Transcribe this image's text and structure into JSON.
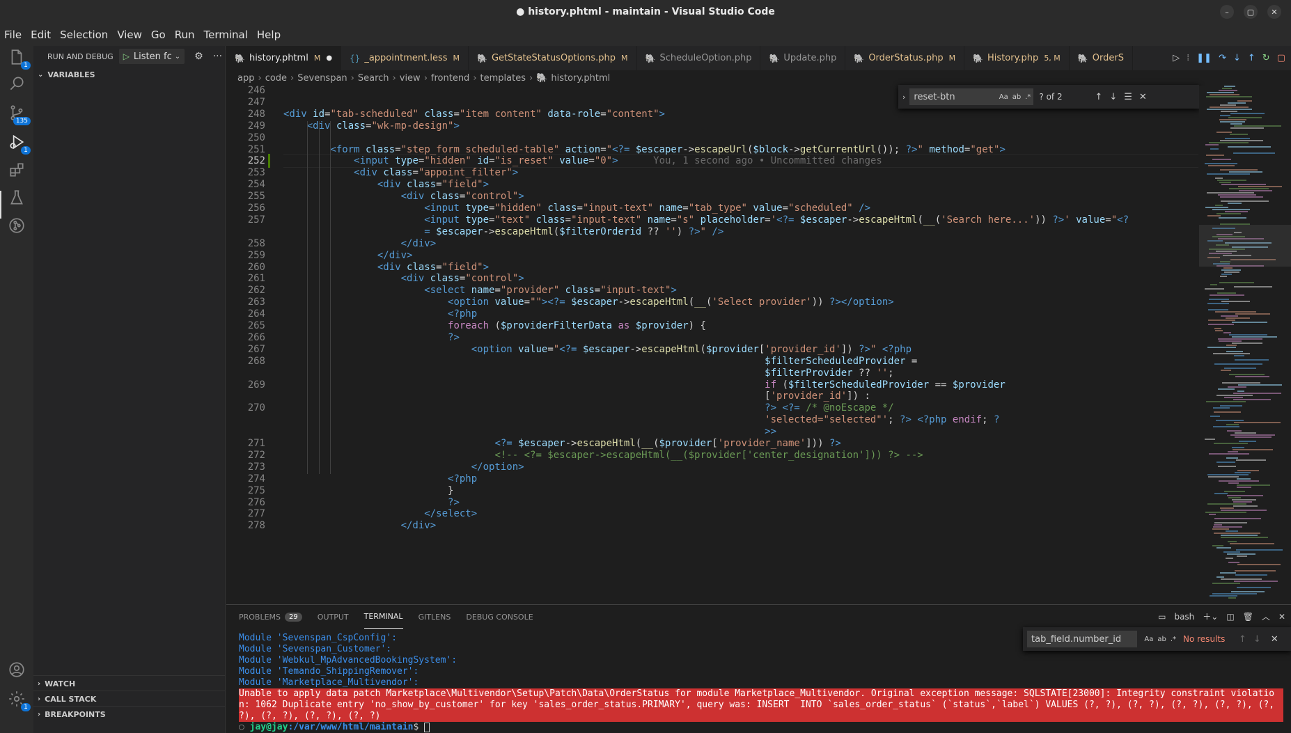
{
  "window": {
    "title": "● history.phtml - maintain - Visual Studio Code"
  },
  "menu": [
    "File",
    "Edit",
    "Selection",
    "View",
    "Go",
    "Run",
    "Terminal",
    "Help"
  ],
  "activity": {
    "scm_badge": "135",
    "explorer_badge": "1",
    "debug_badge": "1",
    "settings_badge": "1"
  },
  "sidebar": {
    "header": "RUN AND DEBUG",
    "config": "Listen fc",
    "sections": {
      "variables": "VARIABLES",
      "watch": "WATCH",
      "callstack": "CALL STACK",
      "breakpoints": "BREAKPOINTS"
    }
  },
  "tabs": [
    {
      "label": "history.phtml",
      "status": "M",
      "dirty": "●",
      "icon_color": "#a074c4"
    },
    {
      "label": "_appointment.less",
      "status": "M",
      "icon": "{}"
    },
    {
      "label": "GetStateStatusOptions.php",
      "status": "M"
    },
    {
      "label": "ScheduleOption.php",
      "status": ""
    },
    {
      "label": "Update.php",
      "status": ""
    },
    {
      "label": "OrderStatus.php",
      "status": "M"
    },
    {
      "label": "History.php",
      "status": "5, M"
    },
    {
      "label": "OrderS",
      "status": ""
    }
  ],
  "breadcrumb": [
    "app",
    "code",
    "Sevenspan",
    "Search",
    "view",
    "frontend",
    "templates",
    "history.phtml"
  ],
  "find": {
    "query": "reset-btn",
    "count": "? of 2",
    "opt_case": "Aa",
    "opt_word": "ab",
    "opt_regex": ".*"
  },
  "editor": {
    "blame": "You, 1 second ago • Uncommitted changes",
    "lines": [
      {
        "n": "246",
        "html": ""
      },
      {
        "n": "247",
        "html": ""
      },
      {
        "n": "248",
        "html": "<span class='t-tag'>&lt;div</span> <span class='t-attr'>id</span>=<span class='t-str'>\"tab-scheduled\"</span> <span class='t-attr'>class</span>=<span class='t-str'>\"item content\"</span> <span class='t-attr'>data-role</span>=<span class='t-str'>\"content\"</span><span class='t-tag'>&gt;</span>"
      },
      {
        "n": "249",
        "html": "    <span class='t-tag'>&lt;div</span> <span class='t-attr'>class</span>=<span class='t-str'>\"wk-mp-design\"</span><span class='t-tag'>&gt;</span>"
      },
      {
        "n": "250",
        "html": ""
      },
      {
        "n": "251",
        "html": "        <span class='t-tag'>&lt;form</span> <span class='t-attr'>class</span>=<span class='t-str'>\"step_form scheduled-table\"</span> <span class='t-attr'>action</span>=<span class='t-str'>\"</span><span class='t-php'>&lt;?=</span> <span class='t-var'>$escaper</span>-&gt;<span class='t-fn'>escapeUrl</span>(<span class='t-var'>$block</span>-&gt;<span class='t-fn'>getCurrentUrl</span>()); <span class='t-php'>?&gt;</span><span class='t-str'>\"</span> <span class='t-attr'>method</span>=<span class='t-str'>\"get\"</span><span class='t-tag'>&gt;</span>"
      },
      {
        "n": "252",
        "html": "            <span class='t-tag'>&lt;input</span> <span class='t-attr'>type</span>=<span class='t-str'>\"hidden\"</span> <span class='t-attr'>id</span>=<span class='t-str'>\"is_reset\"</span> <span class='t-attr'>value</span>=<span class='t-str'>\"0\"</span><span class='t-tag'>&gt;</span>      <span class='t-ghost'>You, 1 second ago • Uncommitted changes</span>",
        "current": true
      },
      {
        "n": "253",
        "html": "            <span class='t-tag'>&lt;div</span> <span class='t-attr'>class</span>=<span class='t-str'>\"appoint_filter\"</span><span class='t-tag'>&gt;</span>"
      },
      {
        "n": "254",
        "html": "                <span class='t-tag'>&lt;div</span> <span class='t-attr'>class</span>=<span class='t-str'>\"field\"</span><span class='t-tag'>&gt;</span>"
      },
      {
        "n": "255",
        "html": "                    <span class='t-tag'>&lt;div</span> <span class='t-attr'>class</span>=<span class='t-str'>\"control\"</span><span class='t-tag'>&gt;</span>"
      },
      {
        "n": "256",
        "html": "                        <span class='t-tag'>&lt;input</span> <span class='t-attr'>type</span>=<span class='t-str'>\"hidden\"</span> <span class='t-attr'>class</span>=<span class='t-str'>\"input-text\"</span> <span class='t-attr'>name</span>=<span class='t-str'>\"tab_type\"</span> <span class='t-attr'>value</span>=<span class='t-str'>\"scheduled\"</span> <span class='t-tag'>/&gt;</span>"
      },
      {
        "n": "257",
        "html": "                        <span class='t-tag'>&lt;input</span> <span class='t-attr'>type</span>=<span class='t-str'>\"text\"</span> <span class='t-attr'>class</span>=<span class='t-str'>\"input-text\"</span> <span class='t-attr'>name</span>=<span class='t-str'>\"s\"</span> <span class='t-attr'>placeholder</span>=<span class='t-str'>'</span><span class='t-php'>&lt;?=</span> <span class='t-var'>$escaper</span>-&gt;<span class='t-fn'>escapeHtml</span>(<span class='t-fn'>__</span>(<span class='t-str'>'Search here...'</span>)) <span class='t-php'>?&gt;</span><span class='t-str'>'</span> <span class='t-attr'>value</span>=<span class='t-str'>\"</span><span class='t-php'>&lt;?</span>"
      },
      {
        "n": "",
        "html": "                        <span class='t-php'>=</span> <span class='t-var'>$escaper</span>-&gt;<span class='t-fn'>escapeHtml</span>(<span class='t-var'>$filterOrderid</span> ?? <span class='t-str'>''</span>) <span class='t-php'>?&gt;</span><span class='t-str'>\"</span> <span class='t-tag'>/&gt;</span>"
      },
      {
        "n": "258",
        "html": "                    <span class='t-tag'>&lt;/div&gt;</span>"
      },
      {
        "n": "259",
        "html": "                <span class='t-tag'>&lt;/div&gt;</span>"
      },
      {
        "n": "260",
        "html": "                <span class='t-tag'>&lt;div</span> <span class='t-attr'>class</span>=<span class='t-str'>\"field\"</span><span class='t-tag'>&gt;</span>"
      },
      {
        "n": "261",
        "html": "                    <span class='t-tag'>&lt;div</span> <span class='t-attr'>class</span>=<span class='t-str'>\"control\"</span><span class='t-tag'>&gt;</span>"
      },
      {
        "n": "262",
        "html": "                        <span class='t-tag'>&lt;select</span> <span class='t-attr'>name</span>=<span class='t-str'>\"provider\"</span> <span class='t-attr'>class</span>=<span class='t-str'>\"input-text\"</span><span class='t-tag'>&gt;</span>"
      },
      {
        "n": "263",
        "html": "                            <span class='t-tag'>&lt;option</span> <span class='t-attr'>value</span>=<span class='t-str'>\"\"</span><span class='t-tag'>&gt;</span><span class='t-php'>&lt;?=</span> <span class='t-var'>$escaper</span>-&gt;<span class='t-fn'>escapeHtml</span>(<span class='t-fn'>__</span>(<span class='t-str'>'Select provider'</span>)) <span class='t-php'>?&gt;</span><span class='t-tag'>&lt;/option&gt;</span>"
      },
      {
        "n": "264",
        "html": "                            <span class='t-php'>&lt;?php</span>"
      },
      {
        "n": "265",
        "html": "                            <span class='t-kw'>foreach</span> (<span class='t-var'>$providerFilterData</span> <span class='t-kw'>as</span> <span class='t-var'>$provider</span>) {"
      },
      {
        "n": "266",
        "html": "                            <span class='t-php'>?&gt;</span>"
      },
      {
        "n": "267",
        "html": "                                <span class='t-tag'>&lt;option</span> <span class='t-attr'>value</span>=<span class='t-str'>\"</span><span class='t-php'>&lt;?=</span> <span class='t-var'>$escaper</span>-&gt;<span class='t-fn'>escapeHtml</span>(<span class='t-var'>$provider</span>[<span class='t-str'>'provider_id'</span>]) <span class='t-php'>?&gt;</span><span class='t-str'>\"</span> <span class='t-php'>&lt;?php</span>"
      },
      {
        "n": "268",
        "html": "                                                                                  <span class='t-var'>$filterScheduledProvider</span> ="
      },
      {
        "n": "",
        "html": "                                                                                  <span class='t-var'>$filterProvider</span> ?? <span class='t-str'>''</span>;"
      },
      {
        "n": "269",
        "html": "                                                                                  <span class='t-kw'>if</span> (<span class='t-var'>$filterScheduledProvider</span> == <span class='t-var'>$provider</span>"
      },
      {
        "n": "",
        "html": "                                                                                  [<span class='t-str'>'provider_id'</span>]) :"
      },
      {
        "n": "270",
        "html": "                                                                                  <span class='t-php'>?&gt;</span> <span class='t-php'>&lt;?=</span> <span class='t-cmt'>/* @noEscape */</span>"
      },
      {
        "n": "",
        "html": "                                                                                  <span class='t-str'>'selected=\"selected\"'</span>; <span class='t-php'>?&gt;</span> <span class='t-php'>&lt;?php</span> <span class='t-kw'>endif</span>; <span class='t-php'>?</span>"
      },
      {
        "n": "",
        "html": "                                                                                  <span class='t-php'>&gt;&gt;</span>"
      },
      {
        "n": "271",
        "html": "                                    <span class='t-php'>&lt;?=</span> <span class='t-var'>$escaper</span>-&gt;<span class='t-fn'>escapeHtml</span>(<span class='t-fn'>__</span>(<span class='t-var'>$provider</span>[<span class='t-str'>'provider_name'</span>])) <span class='t-php'>?&gt;</span>"
      },
      {
        "n": "272",
        "html": "                                    <span class='t-cmt'>&lt;!-- &lt;?= $escaper-&gt;escapeHtml(__($provider['center_designation'])) ?&gt; --&gt;</span>"
      },
      {
        "n": "273",
        "html": "                                <span class='t-tag'>&lt;/option&gt;</span>"
      },
      {
        "n": "274",
        "html": "                            <span class='t-php'>&lt;?php</span>"
      },
      {
        "n": "275",
        "html": "                            }"
      },
      {
        "n": "276",
        "html": "                            <span class='t-php'>?&gt;</span>"
      },
      {
        "n": "277",
        "html": "                        <span class='t-tag'>&lt;/select&gt;</span>"
      },
      {
        "n": "278",
        "html": "                    <span class='t-tag'>&lt;/div&gt;</span>"
      }
    ]
  },
  "panel": {
    "tabs": [
      {
        "label": "PROBLEMS",
        "count": "29"
      },
      {
        "label": "OUTPUT"
      },
      {
        "label": "TERMINAL",
        "active": true
      },
      {
        "label": "GITLENS"
      },
      {
        "label": "DEBUG CONSOLE"
      }
    ],
    "shell": "bash",
    "find": {
      "query": "tab_field.number_id",
      "result": "No results",
      "opt_case": "Aa",
      "opt_word": "ab",
      "opt_regex": ".*"
    },
    "terminal": {
      "modules": [
        "Module 'Sevenspan_CspConfig':",
        "Module 'Sevenspan_Customer':",
        "Module 'Webkul_MpAdvancedBookingSystem':",
        "Module 'Temando_ShippingRemover':",
        "Module 'Marketplace_Multivendor':"
      ],
      "error": "Unable to apply data patch Marketplace\\Multivendor\\Setup\\Patch\\Data\\OrderStatus for module Marketplace_Multivendor. Original exception message: SQLSTATE[23000]: Integrity constraint violation: 1062 Duplicate entry 'no_show_by_customer' for key 'sales_order_status.PRIMARY', query was: INSERT  INTO `sales_order_status` (`status`,`label`) VALUES (?, ?), (?, ?), (?, ?), (?, ?), (?, ?), (?, ?), (?, ?), (?, ?)",
      "prompt_user": "jay@jay",
      "prompt_path": ":/var/www/html/maintain",
      "prompt_symbol": "$ "
    }
  },
  "colors": {
    "accent": "#0e74d8",
    "error_bg": "#cd3131",
    "modified": "#e2c08d"
  }
}
